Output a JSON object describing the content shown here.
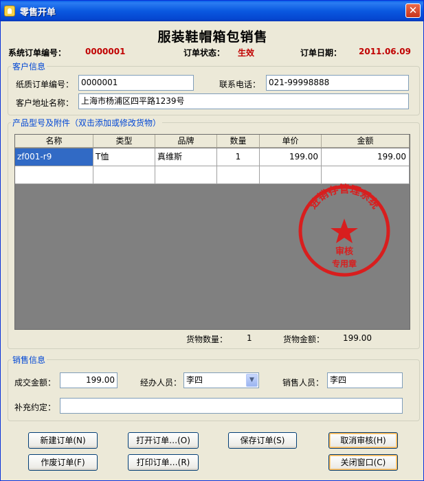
{
  "window": {
    "title": "零售开单",
    "close_glyph": "✕"
  },
  "header": {
    "main_title": "服装鞋帽箱包销售",
    "order_no_label": "系统订单编号：",
    "order_no": "0000001",
    "status_label": "订单状态：",
    "status": "生效",
    "date_label": "订单日期：",
    "date": "2011.06.09"
  },
  "customer": {
    "legend": "客户信息",
    "paper_no_label": "纸质订单编号：",
    "paper_no": "0000001",
    "phone_label": "联系电话：",
    "phone": "021-99998888",
    "address_label": "客户地址名称：",
    "address": "上海市杨浦区四平路1239号"
  },
  "products": {
    "legend": "产品型号及附件（双击添加或修改货物）",
    "columns": [
      "名称",
      "类型",
      "品牌",
      "数量",
      "单价",
      "金额"
    ],
    "rows": [
      [
        "zf001-r9",
        "T恤",
        "真维斯",
        "1",
        "199.00",
        "199.00"
      ]
    ],
    "qty_label": "货物数量：",
    "qty_total": "1",
    "amount_label": "货物金额：",
    "amount_total": "199.00",
    "seal": {
      "text_top": "进销存管理系统",
      "text_mid": "审核",
      "text_bottom": "专用章",
      "color": "#d81e1e"
    }
  },
  "sale": {
    "legend": "销售信息",
    "deal_label": "成交金额：",
    "deal_amount": "199.00",
    "handler_label": "经办人员：",
    "handler": "李四",
    "seller_label": "销售人员：",
    "seller": "李四",
    "notes_label": "补充约定：",
    "notes": ""
  },
  "buttons": {
    "new_order": "新建订单(N)",
    "open_order": "打开订单…(O)",
    "save_order": "保存订单(S)",
    "cancel_review": "取消审核(H)",
    "void_order": "作废订单(F)",
    "print_order": "打印订单…(R)",
    "close_window": "关闭窗口(C)"
  }
}
